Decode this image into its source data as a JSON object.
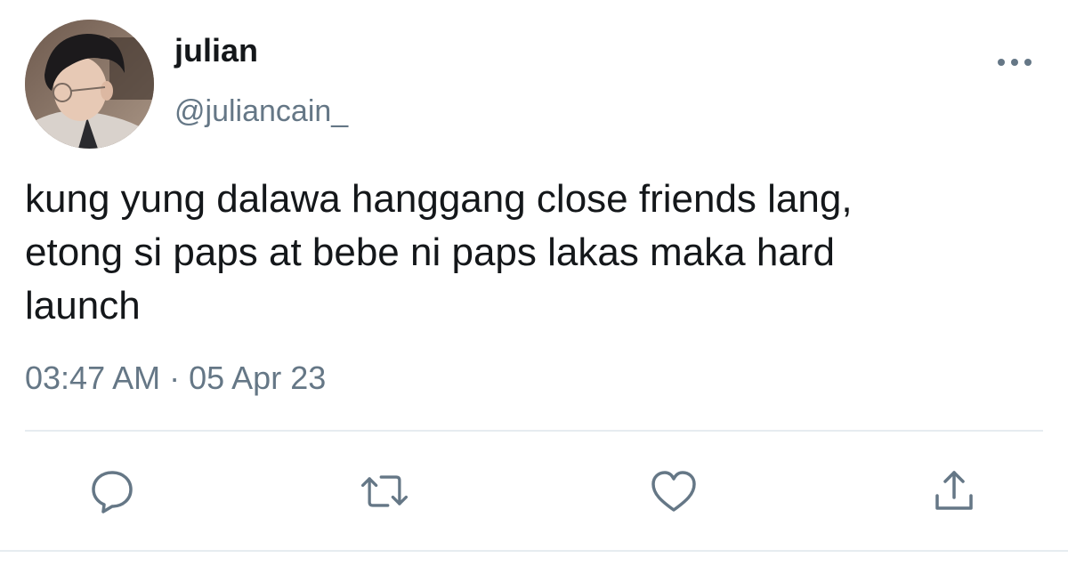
{
  "user": {
    "display_name": "julian",
    "handle": "@juliancain_"
  },
  "tweet": {
    "lines": [
      "kung yung dalawa hanggang close friends lang,",
      "etong si paps at bebe ni paps lakas maka hard",
      "launch"
    ],
    "time": "03:47 AM",
    "separator": "·",
    "date": "05 Apr 23"
  },
  "icons": {
    "more": "more-dots-icon",
    "reply": "reply-bubble-icon",
    "retweet": "retweet-icon",
    "like": "heart-icon",
    "share": "share-upload-icon"
  },
  "colors": {
    "text": "#14171a",
    "secondary": "#657786",
    "icon": "#657786",
    "divider": "#e6ecf0"
  }
}
